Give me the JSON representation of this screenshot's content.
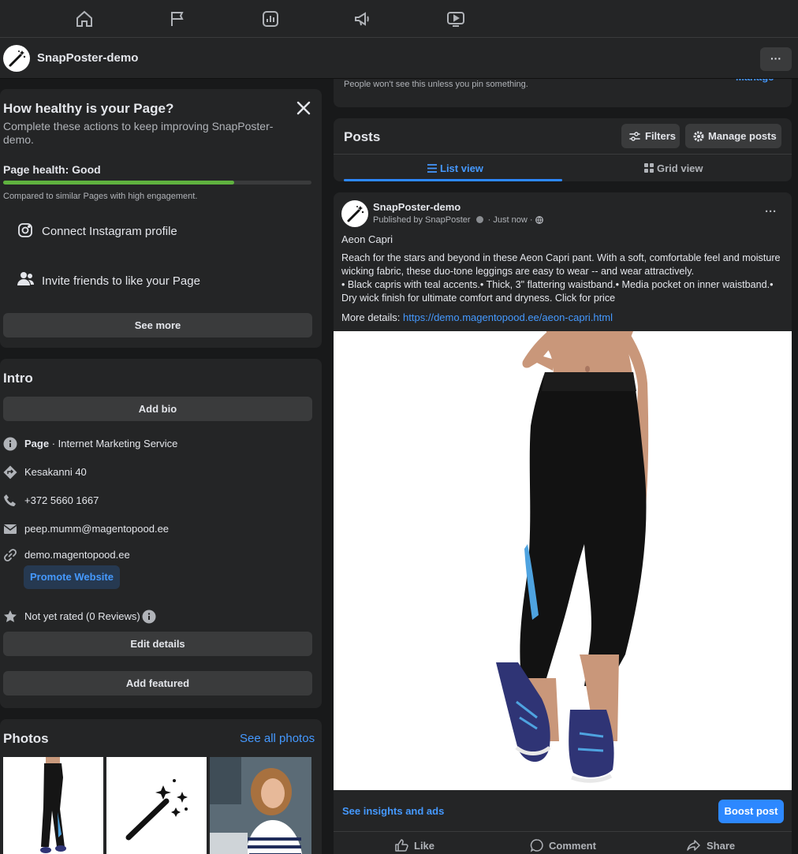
{
  "nav": {
    "icons": [
      "home-icon",
      "flag-icon",
      "insights-icon",
      "megaphone-icon",
      "video-icon"
    ]
  },
  "page": {
    "name": "SnapPoster-demo",
    "more_label": "···"
  },
  "pin_note": "People won't see this unless you pin something.",
  "pin_manage": "Manage",
  "health": {
    "title": "How healthy is your Page?",
    "subtitle": "Complete these actions to keep improving SnapPoster-demo.",
    "status_label": "Page health: Good",
    "progress": 0.75,
    "compare": "Compared to similar Pages with high engagement.",
    "actions": [
      {
        "label": "Connect Instagram profile",
        "icon": "instagram-icon"
      },
      {
        "label": "Invite friends to like your Page",
        "icon": "people-icon"
      }
    ],
    "see_more": "See more"
  },
  "intro": {
    "title": "Intro",
    "add_bio": "Add bio",
    "category_bold": "Page",
    "category_rest": " · Internet Marketing Service",
    "address": "Kesakanni 40",
    "phone": "+372 5660 1667",
    "email": "peep.mumm@magentopood.ee",
    "website": "demo.magentopood.ee",
    "promote": "Promote Website",
    "rating": "Not yet rated (0 Reviews)",
    "edit_details": "Edit details",
    "add_featured": "Add featured"
  },
  "photos": {
    "title": "Photos",
    "see_all": "See all photos"
  },
  "posts": {
    "title": "Posts",
    "filters": "Filters",
    "manage": "Manage posts",
    "list_view": "List view",
    "grid_view": "Grid view"
  },
  "post": {
    "author": "SnapPoster-demo",
    "published_by": "Published by SnapPoster",
    "time": "Just now",
    "title": "Aeon Capri",
    "body": "Reach for the stars and beyond in these Aeon Capri pant. With a soft, comfortable feel and moisture wicking fabric, these duo-tone leggings are easy to wear -- and wear attractively.\n• Black capris with teal accents.• Thick, 3\" flattering waistband.• Media pocket on inner waistband.• Dry wick finish for ultimate comfort and dryness. Click for price",
    "more_details_label": "More details: ",
    "more_details_url": "https://demo.magentopood.ee/aeon-capri.html",
    "insights": "See insights and ads",
    "boost": "Boost post",
    "like": "Like",
    "comment": "Comment",
    "share": "Share"
  },
  "colors": {
    "accent": "#2d88ff",
    "link": "#4599ff",
    "health_good": "#5fb23f",
    "background": "#18191a",
    "card": "#242526"
  }
}
